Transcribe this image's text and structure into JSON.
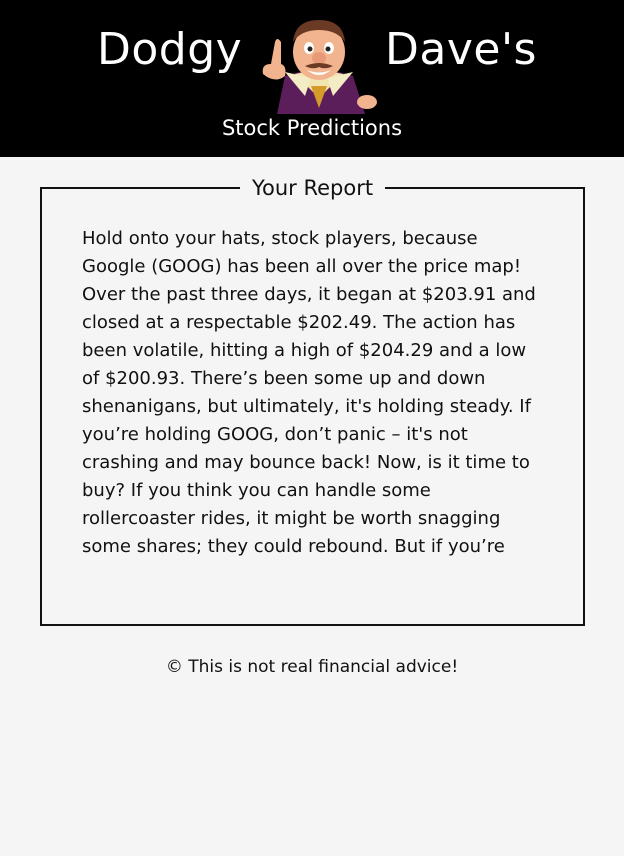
{
  "header": {
    "brand_left": "Dodgy",
    "brand_right": "Dave's",
    "tagline": "Stock Predictions",
    "mascot_icon": "cartoon-salesman-mascot-icon"
  },
  "report": {
    "title": "Your Report",
    "text": "Hold onto your hats, stock players, because Google (GOOG) has been all over the price map! Over the past three days, it began at $203.91 and closed at a respectable $202.49. The action has been volatile, hitting a high of $204.29 and a low of $200.93. There’s been some up and down shenanigans, but ultimately, it's holding steady. If you’re holding GOOG, don’t panic – it's not crashing and may bounce back! Now, is it time to buy? If you think you can handle some rollercoaster rides, it might be worth snagging some shares; they could rebound. But if you’re"
  },
  "footer": {
    "disclaimer": "© This is not real financial advice!"
  },
  "colors": {
    "header_bg": "#000000",
    "page_bg": "#f5f5f5",
    "text": "#111111"
  }
}
